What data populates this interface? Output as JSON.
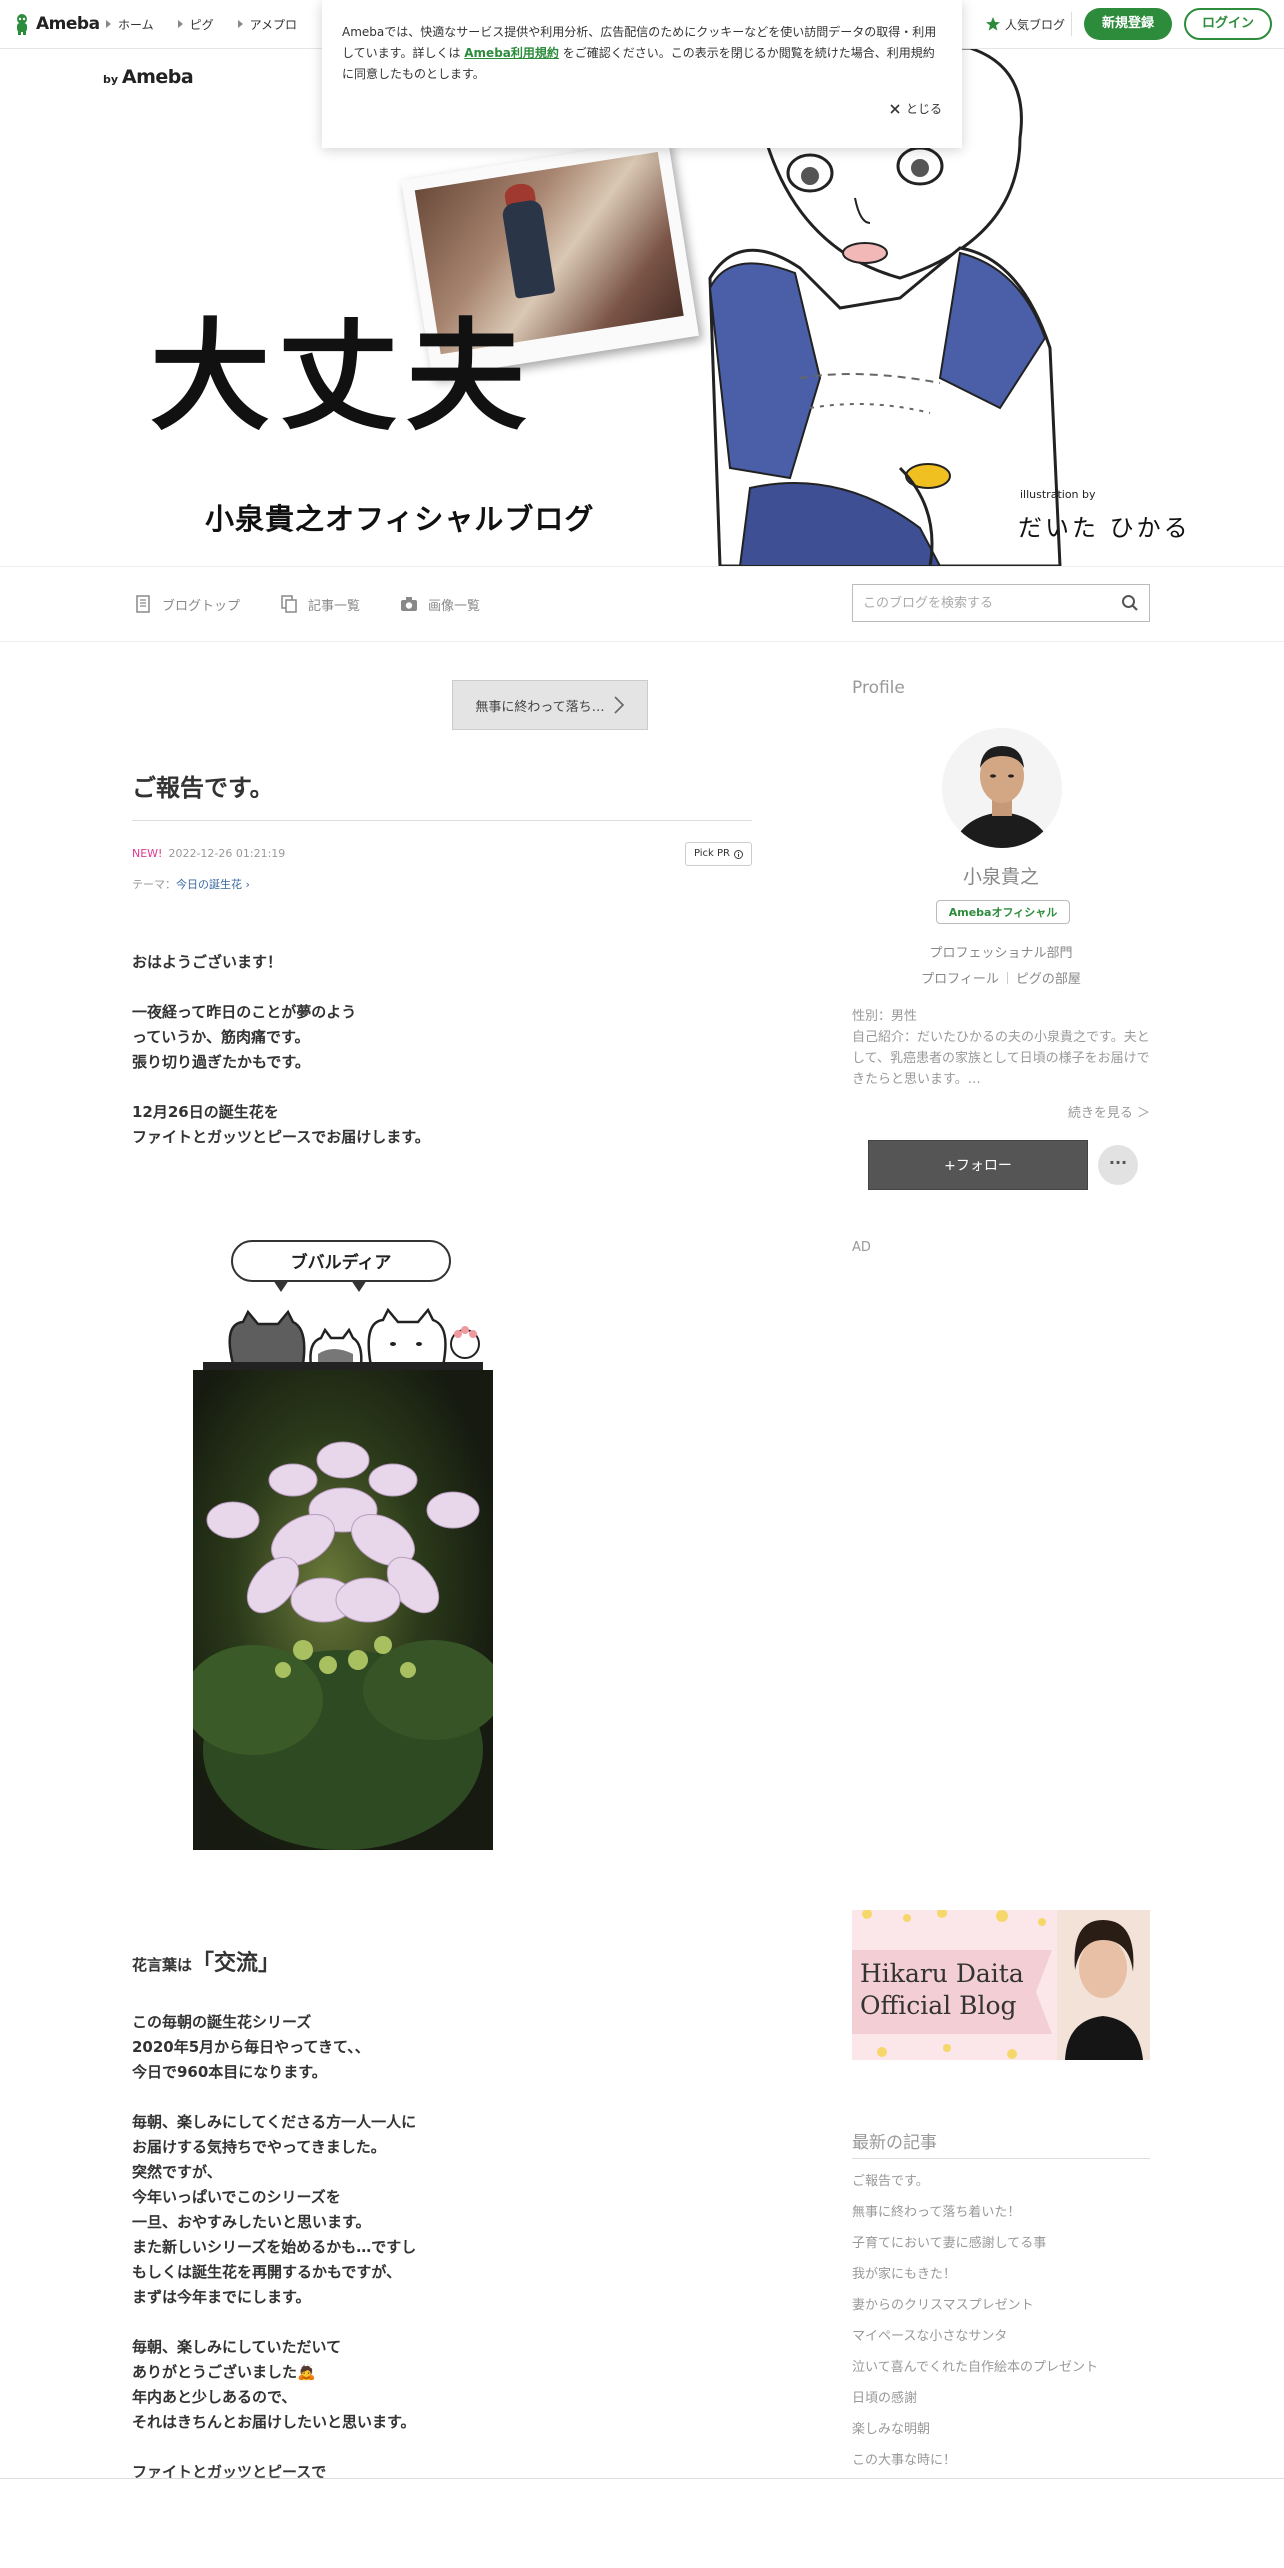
{
  "global_header": {
    "logo_text": "Ameba",
    "nav": [
      "ホーム",
      "ピグ",
      "アメプロ"
    ],
    "popular_blog": "人気ブログ",
    "signup": "新規登録",
    "login": "ログイン"
  },
  "cookie_notice": {
    "text_before": "Amebaでは、快適なサービス提供や利用分析、広告配信のためにクッキーなどを使い訪問データの取得・利用しています。詳しくは ",
    "link": "Ameba利用規約",
    "text_after": " をご確認ください。この表示を閉じるか閲覧を続けた場合、利用規約に同意したものとします。",
    "close": "とじる"
  },
  "banner": {
    "by": "by",
    "ameba": "Ameba",
    "title": "大丈夫",
    "subtitle": "小泉貴之オフィシャルブログ",
    "illustration_by": "illustration by",
    "illustrator": "だいた ひかる"
  },
  "blog_nav": {
    "items": [
      "ブログトップ",
      "記事一覧",
      "画像一覧"
    ],
    "search_placeholder": "このブログを検索する"
  },
  "entry": {
    "prev_link": "無事に終わって落ち…",
    "title": "ご報告です。",
    "new_label": "NEW!",
    "datetime": "2022-12-26 01:21:19",
    "pick_pr": "Pick PR",
    "theme_label": "テーマ：",
    "theme": "今日の誕生花",
    "para1": "おはようございます！",
    "para2": "一夜経って昨日のことが夢のよう\nっていうか、筋肉痛です。\n張り切り過ぎたかもです。",
    "para3": "12月26日の誕生花を\nファイトとガッツとピースでお届けします。",
    "flower_bubble": "ブバルディア",
    "keyword_prefix": "花言葉は",
    "keyword": "「交流」",
    "para4": "この毎朝の誕生花シリーズ\n2020年5月から毎日やってきて、、\n今日で960本目になります。",
    "para5": "毎朝、楽しみにしてくださる方一人一人に\nお届けする気持ちでやってきました。\n突然ですが、\n今年いっぱいでこのシリーズを\n一旦、おやすみしたいと思います。\nまた新しいシリーズを始めるかも…ですし\nもしくは誕生花を再開するかもですが、\nまずは今年までにします。",
    "para6": "毎朝、楽しみにしていただいて\nありがとうございました🙇\n年内あと少しあるので、\nそれはきちんとお届けしたいと思います。",
    "para7": "ファイトとガッツとピースで"
  },
  "sidebar": {
    "profile_heading": "Profile",
    "name": "小泉貴之",
    "official_badge": "Amebaオフィシャル",
    "category": "プロフェッショナル部門",
    "link_profile": "プロフィール",
    "link_pig": "ピグの部屋",
    "gender": "性別：男性",
    "intro": "自己紹介：だいたひかるの夫の小泉貴之です。夫として、乳癌患者の家族として日頃の様子をお届けできたらと思います。…",
    "read_more": "続きを見る ＞",
    "follow": "+フォロー",
    "more": "···",
    "ad": "AD",
    "hikaru_banner": "Hikaru Daita\nOfficial Blog",
    "latest_heading": "最新の記事",
    "latest": [
      "ご報告です。",
      "無事に終わって落ち着いた！",
      "子育てにおいて妻に感謝してる事",
      "我が家にもきた！",
      "妻からのクリスマスプレゼント",
      "マイペースな小さなサンタ",
      "泣いて喜んでくれた自作絵本のプレゼント",
      "日頃の感謝",
      "楽しみな明朝",
      "この大事な時に！"
    ]
  },
  "colors": {
    "brand_green": "#2d8c3c",
    "new_pink": "#e0388a",
    "link_blue": "#3b6aa0"
  }
}
